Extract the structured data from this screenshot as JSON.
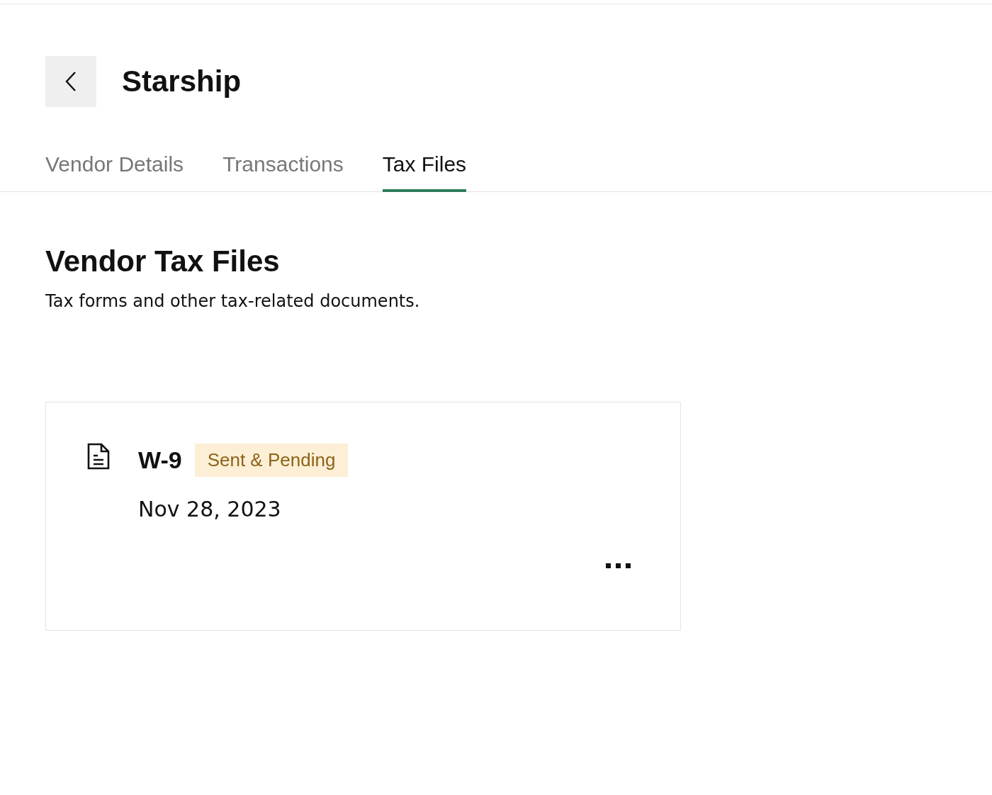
{
  "header": {
    "title": "Starship"
  },
  "tabs": [
    {
      "label": "Vendor Details",
      "selected": false
    },
    {
      "label": "Transactions",
      "selected": false
    },
    {
      "label": "Tax Files",
      "selected": true
    }
  ],
  "section": {
    "title": "Vendor Tax Files",
    "subtitle": "Tax forms and other tax-related documents."
  },
  "files": [
    {
      "name": "W-9",
      "status": {
        "label": "Sent & Pending",
        "kind": "pending"
      },
      "date": "Nov 28, 2023"
    }
  ]
}
